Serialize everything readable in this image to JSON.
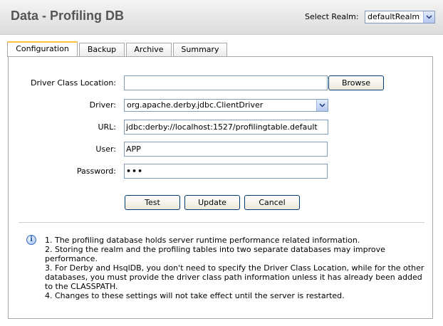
{
  "header": {
    "title": "Data - Profiling DB",
    "realm_label": "Select Realm:",
    "realm_value": "defaultRealm"
  },
  "tabs": [
    {
      "label": "Configuration",
      "active": true
    },
    {
      "label": "Backup",
      "active": false
    },
    {
      "label": "Archive",
      "active": false
    },
    {
      "label": "Summary",
      "active": false
    }
  ],
  "form": {
    "driver_class_location": {
      "label": "Driver Class Location:",
      "value": ""
    },
    "browse_label": "Browse",
    "driver": {
      "label": "Driver:",
      "value": "org.apache.derby.jdbc.ClientDriver"
    },
    "url": {
      "label": "URL:",
      "value": "jdbc:derby://localhost:1527/profilingtable.default"
    },
    "user": {
      "label": "User:",
      "value": "APP"
    },
    "password": {
      "label": "Password:",
      "value": "•••"
    }
  },
  "buttons": {
    "test": "Test",
    "update": "Update",
    "cancel": "Cancel"
  },
  "notes": [
    "1. The profiling database holds server runtime performance related information.",
    "2. Storing the realm and the profiling tables into two separate databases may improve performance.",
    "3. For Derby and HsqlDB, you don't need to specify the Driver Class Location, while for the other databases, you must provide the driver class path information unless it has already been added to the CLASSPATH.",
    "4. Changes to these settings will not take effect until the server is restarted."
  ],
  "icons": {
    "info": "info-icon",
    "dropdown": "chevron-down-icon"
  }
}
